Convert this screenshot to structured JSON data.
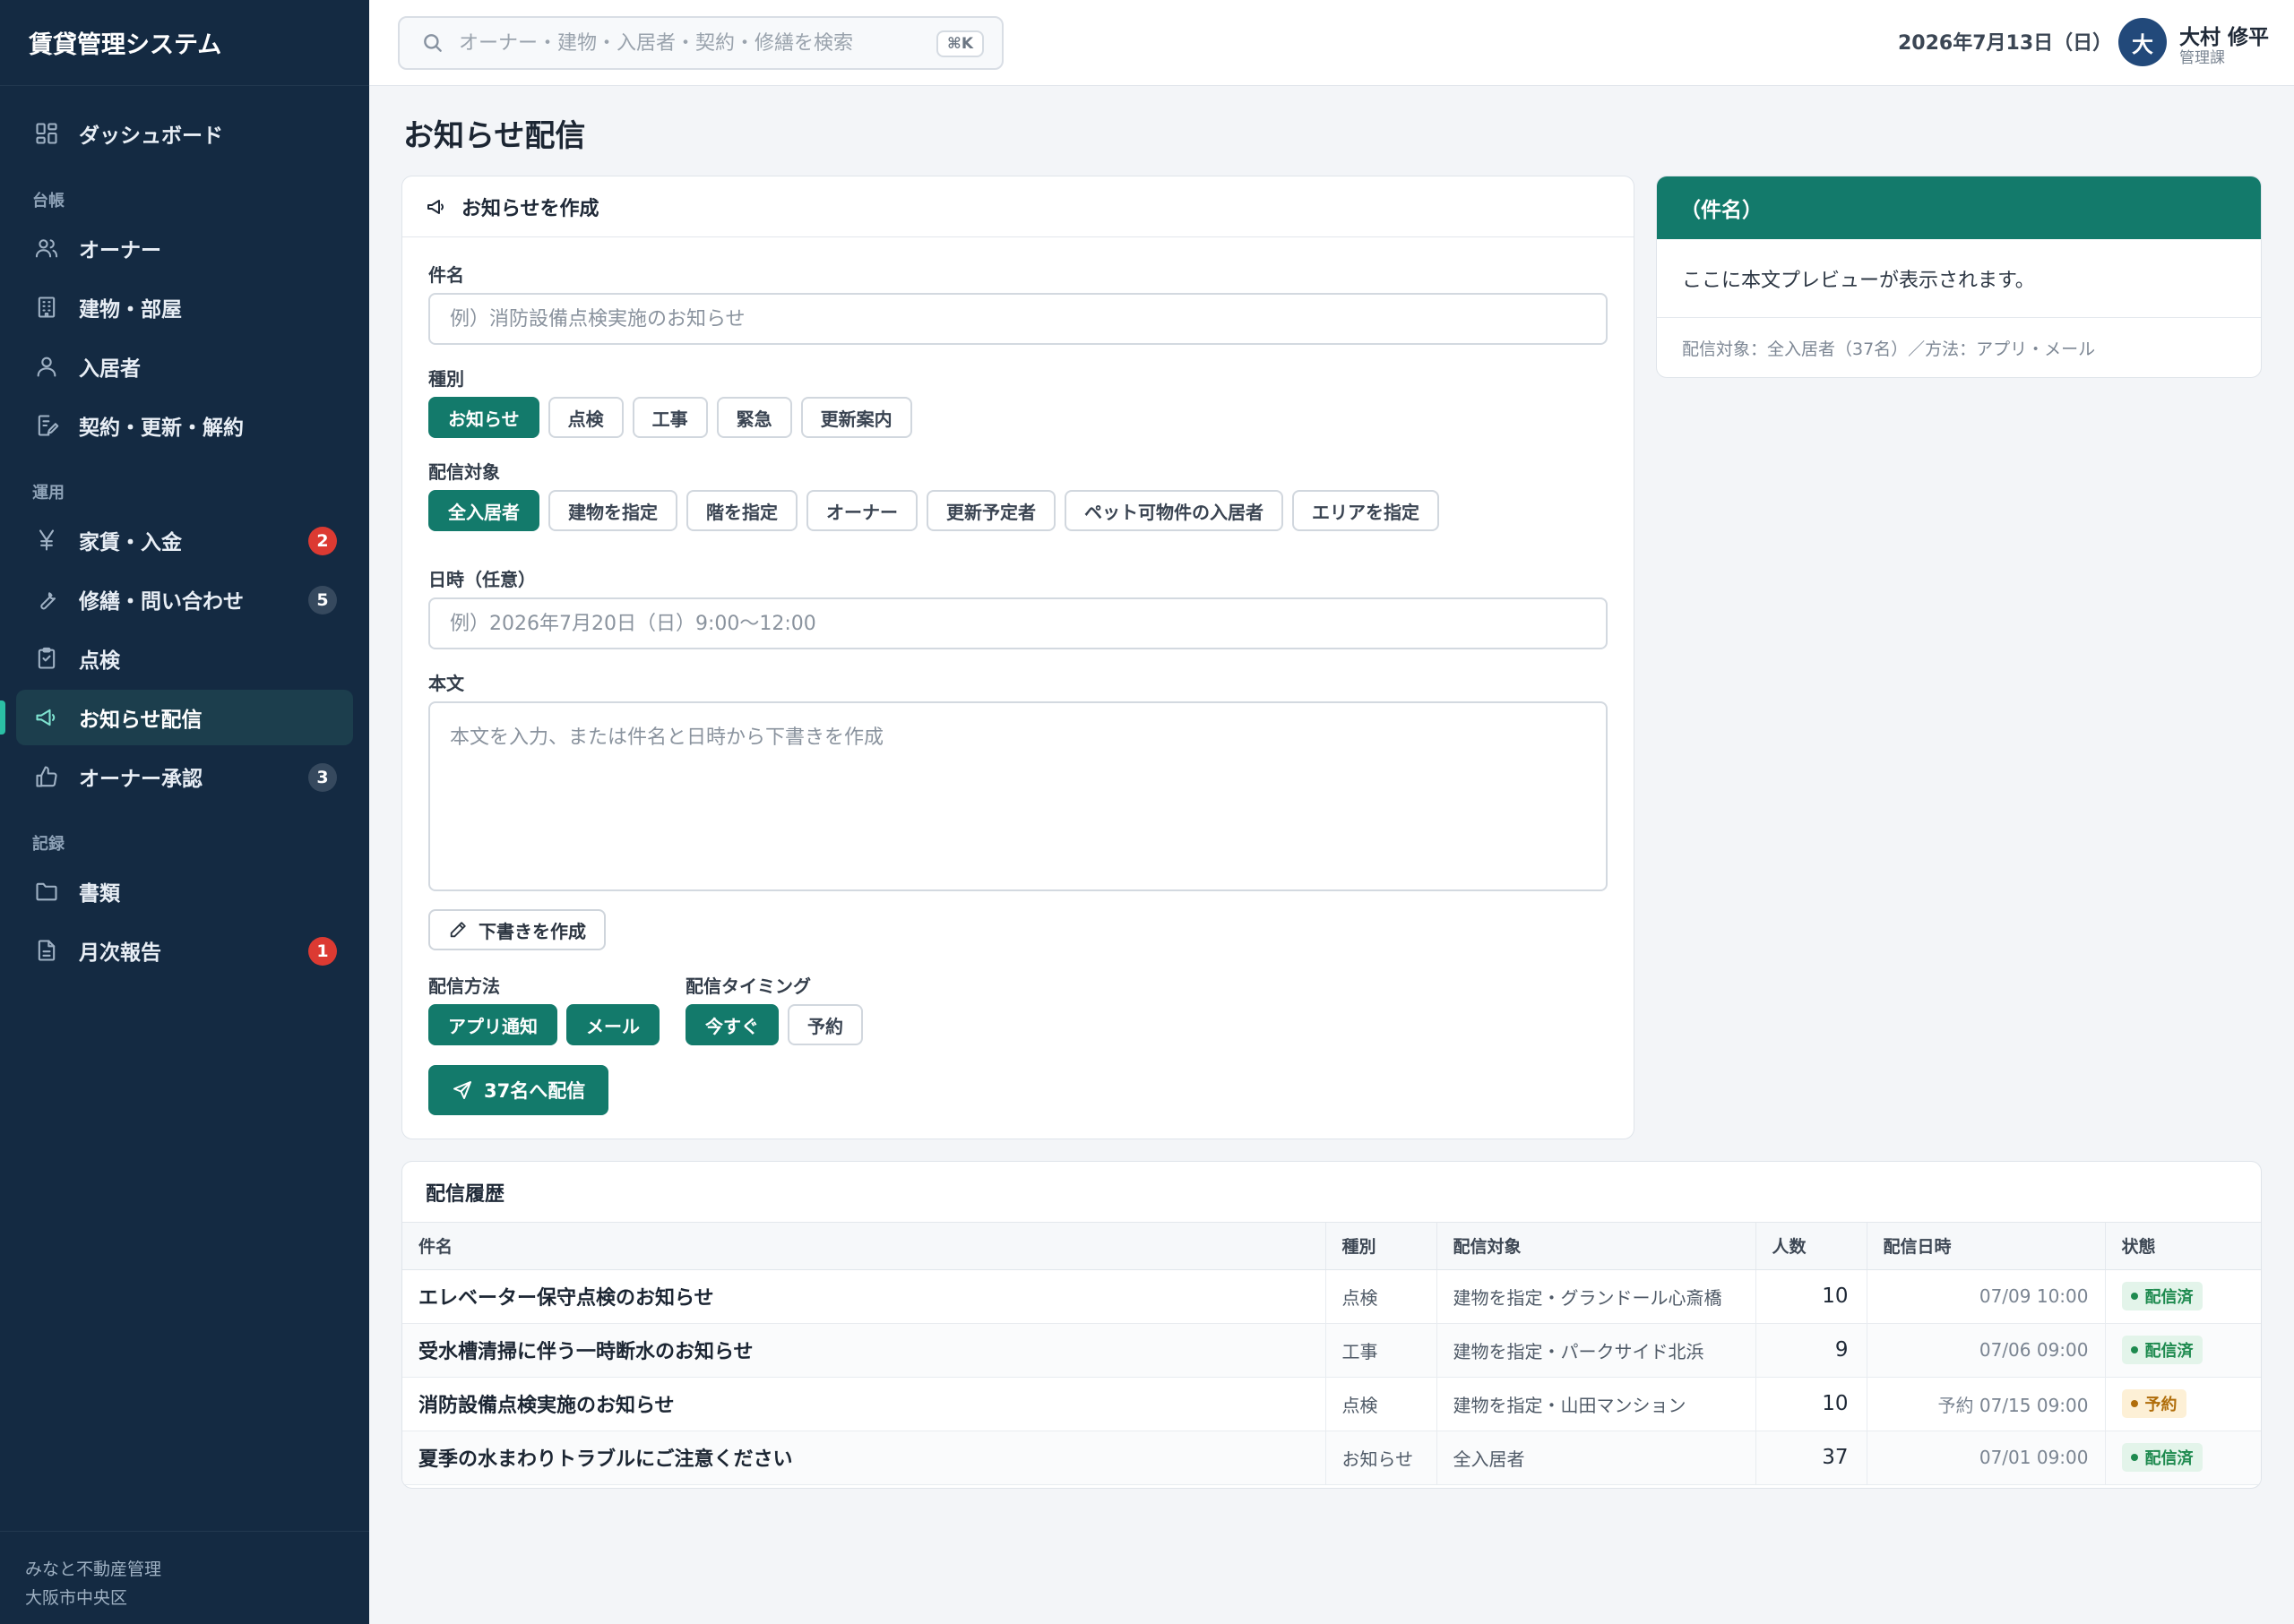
{
  "app": {
    "title": "賃貸管理システム"
  },
  "sidebar": {
    "dashboard": "ダッシュボード",
    "sections": {
      "ledger": "台帳",
      "ops": "運用",
      "records": "記録"
    },
    "items": {
      "owner": "オーナー",
      "buildings": "建物・部屋",
      "tenants": "入居者",
      "contracts": "契約・更新・解約",
      "rent": "家賃・入金",
      "repair": "修繕・問い合わせ",
      "inspection": "点検",
      "notice": "お知らせ配信",
      "approval": "オーナー承認",
      "documents": "書類",
      "monthly": "月次報告"
    },
    "badges": {
      "rent": "2",
      "repair": "5",
      "approval": "3",
      "monthly": "1"
    },
    "footer": {
      "company": "みなと不動産管理",
      "location": "大阪市中央区"
    }
  },
  "topbar": {
    "search_placeholder": "オーナー・建物・入居者・契約・修繕を検索",
    "shortcut": "⌘K",
    "date": "2026年7月13日（日）",
    "user": {
      "initial": "大",
      "name": "大村 修平",
      "role": "管理課"
    }
  },
  "page": {
    "title": "お知らせ配信"
  },
  "compose": {
    "header": "お知らせを作成",
    "subject_label": "件名",
    "subject_placeholder": "例）消防設備点検実施のお知らせ",
    "type_label": "種別",
    "types": [
      "お知らせ",
      "点検",
      "工事",
      "緊急",
      "更新案内"
    ],
    "target_label": "配信対象",
    "targets": [
      "全入居者",
      "建物を指定",
      "階を指定",
      "オーナー",
      "更新予定者",
      "ペット可物件の入居者",
      "エリアを指定"
    ],
    "datetime_label": "日時（任意）",
    "datetime_placeholder": "例）2026年7月20日（日）9:00〜12:00",
    "body_label": "本文",
    "body_placeholder": "本文を入力、または件名と日時から下書きを作成",
    "draft_button": "下書きを作成",
    "method_label": "配信方法",
    "methods": [
      "アプリ通知",
      "メール"
    ],
    "timing_label": "配信タイミング",
    "timings": [
      "今すぐ",
      "予約"
    ],
    "send_button": "37名へ配信"
  },
  "preview": {
    "title": "（件名）",
    "body": "ここに本文プレビューが表示されます。",
    "meta": "配信対象：全入居者（37名）／方法：アプリ・メール"
  },
  "history": {
    "header": "配信履歴",
    "columns": [
      "件名",
      "種別",
      "配信対象",
      "人数",
      "配信日時",
      "状態"
    ],
    "rows": [
      {
        "subject": "エレベーター保守点検のお知らせ",
        "type": "点検",
        "target": "建物を指定・グランドール心斎橋",
        "count": "10",
        "datetime": "07/09 10:00",
        "status": "配信済"
      },
      {
        "subject": "受水槽清掃に伴う一時断水のお知らせ",
        "type": "工事",
        "target": "建物を指定・パークサイド北浜",
        "count": "9",
        "datetime": "07/06 09:00",
        "status": "配信済"
      },
      {
        "subject": "消防設備点検実施のお知らせ",
        "type": "点検",
        "target": "建物を指定・山田マンション",
        "count": "10",
        "datetime": "予約 07/15 09:00",
        "status": "予約"
      },
      {
        "subject": "夏季の水まわりトラブルにご注意ください",
        "type": "お知らせ",
        "target": "全入居者",
        "count": "37",
        "datetime": "07/01 09:00",
        "status": "配信済"
      }
    ]
  },
  "colors": {
    "sidebar": "#142a42",
    "accent": "#137a6b",
    "badge_red": "#dc3a32"
  }
}
